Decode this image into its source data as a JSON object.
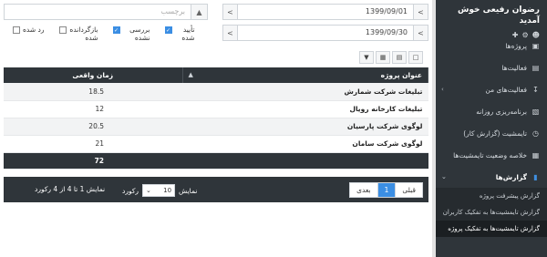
{
  "sidebar": {
    "welcome": "رضوان رفیعی خوش آمدید",
    "items": [
      {
        "label": "پروژه‌ها",
        "icon": "briefcase"
      },
      {
        "label": "فعالیت‌ها",
        "icon": "tasks"
      },
      {
        "label": "فعالیت‌های من",
        "icon": "download",
        "has_chevron": true
      },
      {
        "label": "برنامه‌ریزی روزانه",
        "icon": "calendar"
      },
      {
        "label": "تایمشیت (گزارش کار)",
        "icon": "clock"
      },
      {
        "label": "خلاصه وضعیت تایمشیت‌ها",
        "icon": "table"
      }
    ],
    "section": {
      "label": "گزارش‌ها",
      "icon": "file"
    },
    "sub_items": [
      {
        "label": "گزارش پیشرفت پروژه"
      },
      {
        "label": "گزارش تایمشیت‌ها به تفکیک کاربران"
      },
      {
        "label": "گزارش تایمشیت‌ها به تفکیک پروژه",
        "active": true
      }
    ]
  },
  "filters": {
    "date_from": "1399/09/01",
    "date_to": "1399/09/30",
    "tag_placeholder": "برچسب",
    "checkboxes": [
      {
        "label": "تأیید شده",
        "checked": true
      },
      {
        "label": "بررسی نشده",
        "checked": true
      },
      {
        "label": "بازگردانده شده",
        "checked": false
      },
      {
        "label": "رد شده",
        "checked": false
      }
    ]
  },
  "table": {
    "columns": [
      "عنوان پروژه",
      "زمان واقعی"
    ],
    "rows": [
      {
        "title": "تبلیغات شرکت شمارش",
        "hours": "18.5"
      },
      {
        "title": "تبلیغات کارخانه رویال",
        "hours": "12"
      },
      {
        "title": "لوگوی شرکت پارسیان",
        "hours": "20.5"
      },
      {
        "title": "لوگوی شرکت سامان",
        "hours": "21"
      }
    ],
    "total": "72"
  },
  "footer": {
    "prev": "قبلی",
    "page": "1",
    "next": "بعدی",
    "show_label": "نمایش",
    "per_page": "10",
    "records_label": "رکورد",
    "info": "نمایش 1 تا 4 از 4 رکورد"
  }
}
